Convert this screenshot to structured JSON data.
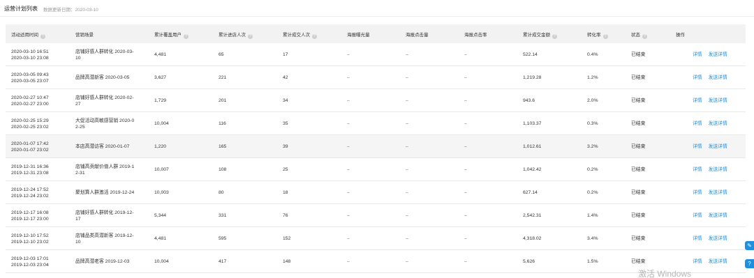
{
  "header": {
    "title": "运营计划列表",
    "update_label": "数据更新日期：2020-03-10"
  },
  "columns": [
    "活动适用时间",
    "营销场景",
    "累计覆盖用户",
    "累计进店人次",
    "累计成交人次",
    "海报曝光量",
    "海报点击量",
    "海报点击率",
    "累计成交金额",
    "转化率",
    "状态",
    "操作"
  ],
  "rows": [
    {
      "time1": "2020-03-10 16:51",
      "time2": "2020-03-10 23:08",
      "scene1": "店铺好感人群转化 2020-03-",
      "scene2": "10",
      "users": "4,481",
      "visits": "65",
      "deals": "17",
      "exposure": "–",
      "clicks": "–",
      "click_rate": "–",
      "amount": "522.14",
      "conv": "0.4%",
      "status": "已结束",
      "detail": "详情",
      "send": "发送详情"
    },
    {
      "time1": "2020-03-05 09:43",
      "time2": "2020-03-05 23:07",
      "scene1": "品牌高潜新客 2020-03-05",
      "scene2": "",
      "users": "3,627",
      "visits": "221",
      "deals": "42",
      "exposure": "–",
      "clicks": "–",
      "click_rate": "–",
      "amount": "1,219.28",
      "conv": "1.2%",
      "status": "已结束",
      "detail": "详情",
      "send": "发送详情"
    },
    {
      "time1": "2020-02-27 10:47",
      "time2": "2020-02-27 23:00",
      "scene1": "店铺好感人群转化 2020-02-",
      "scene2": "27",
      "users": "1,729",
      "visits": "201",
      "deals": "34",
      "exposure": "–",
      "clicks": "–",
      "click_rate": "–",
      "amount": "943.6",
      "conv": "2.0%",
      "status": "已结束",
      "detail": "详情",
      "send": "发送详情"
    },
    {
      "time1": "2020-02-25 15:29",
      "time2": "2020-02-25 23:02",
      "scene1": "大促活动高敏感营销 2020-0",
      "scene2": "2-25",
      "users": "10,004",
      "visits": "116",
      "deals": "35",
      "exposure": "–",
      "clicks": "–",
      "click_rate": "–",
      "amount": "1,103.37",
      "conv": "0.3%",
      "status": "已结束",
      "detail": "详情",
      "send": "发送详情"
    },
    {
      "time1": "2020-01-07 17:42",
      "time2": "2020-01-07 23:02",
      "scene1": "本店高潜访客 2020-01-07",
      "scene2": "",
      "users": "1,220",
      "visits": "165",
      "deals": "39",
      "exposure": "–",
      "clicks": "–",
      "click_rate": "–",
      "amount": "1,012.61",
      "conv": "3.2%",
      "status": "已结束",
      "detail": "详情",
      "send": "发送详情"
    },
    {
      "time1": "2019-12-31 16:36",
      "time2": "2019-12-31 23:08",
      "scene1": "店铺高贡献价值人群 2019-1",
      "scene2": "2-31",
      "users": "10,007",
      "visits": "108",
      "deals": "25",
      "exposure": "–",
      "clicks": "–",
      "click_rate": "–",
      "amount": "1,042.42",
      "conv": "0.2%",
      "status": "已结束",
      "detail": "详情",
      "send": "发送详情"
    },
    {
      "time1": "2019-12-24 17:52",
      "time2": "2019-12-24 23:02",
      "scene1": "聚划算人群激活 2019-12-24",
      "scene2": "",
      "users": "10,003",
      "visits": "80",
      "deals": "18",
      "exposure": "–",
      "clicks": "–",
      "click_rate": "–",
      "amount": "627.14",
      "conv": "0.2%",
      "status": "已结束",
      "detail": "详情",
      "send": "发送详情"
    },
    {
      "time1": "2019-12-17 16:08",
      "time2": "2019-12-17 23:00",
      "scene1": "店铺好感人群转化 2019-12-",
      "scene2": "17",
      "users": "5,344",
      "visits": "331",
      "deals": "76",
      "exposure": "–",
      "clicks": "–",
      "click_rate": "–",
      "amount": "2,542.31",
      "conv": "1.4%",
      "status": "已结束",
      "detail": "详情",
      "send": "发送详情"
    },
    {
      "time1": "2019-12-10 17:52",
      "time2": "2019-12-10 23:02",
      "scene1": "店铺品类高潜新客 2019-12-",
      "scene2": "10",
      "users": "4,481",
      "visits": "595",
      "deals": "152",
      "exposure": "–",
      "clicks": "–",
      "click_rate": "–",
      "amount": "4,318.02",
      "conv": "3.4%",
      "status": "已结束",
      "detail": "详情",
      "send": "发送详情"
    },
    {
      "time1": "2019-12-03 17:01",
      "time2": "2019-12-03 23:04",
      "scene1": "品牌高潜老客 2019-12-03",
      "scene2": "",
      "users": "10,004",
      "visits": "417",
      "deals": "148",
      "exposure": "–",
      "clicks": "–",
      "click_rate": "–",
      "amount": "5,626",
      "conv": "1.5%",
      "status": "已结束",
      "detail": "详情",
      "send": "发送详情"
    }
  ],
  "info_icon": "question-circle-icon",
  "watermark": "激活 Windows",
  "accent": "#1f8fe0"
}
